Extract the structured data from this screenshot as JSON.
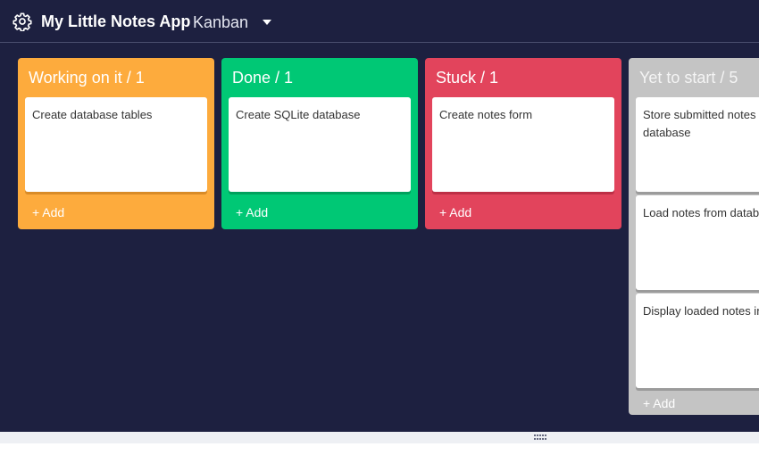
{
  "header": {
    "app_title": "My Little Notes App",
    "view_label": "Kanban",
    "settings_icon": "gear-icon",
    "dropdown_icon": "caret-down-icon"
  },
  "colors": {
    "background": "#1d2040",
    "working": "#fdab3d",
    "done": "#00c875",
    "stuck": "#e2445c",
    "yet_to_start": "#c4c4c4"
  },
  "columns": [
    {
      "title": "Working on it / 1",
      "cards": [
        "Create database tables"
      ],
      "add_label": "+ Add"
    },
    {
      "title": "Done / 1",
      "cards": [
        "Create SQLite database"
      ],
      "add_label": "+ Add"
    },
    {
      "title": "Stuck / 1",
      "cards": [
        "Create notes form"
      ],
      "add_label": "+ Add"
    },
    {
      "title": "Yet to start / 5",
      "cards": [
        "Store submitted notes i\ndatabase",
        "Load notes from databa",
        "Display loaded notes in"
      ],
      "add_label": "+ Add"
    }
  ]
}
